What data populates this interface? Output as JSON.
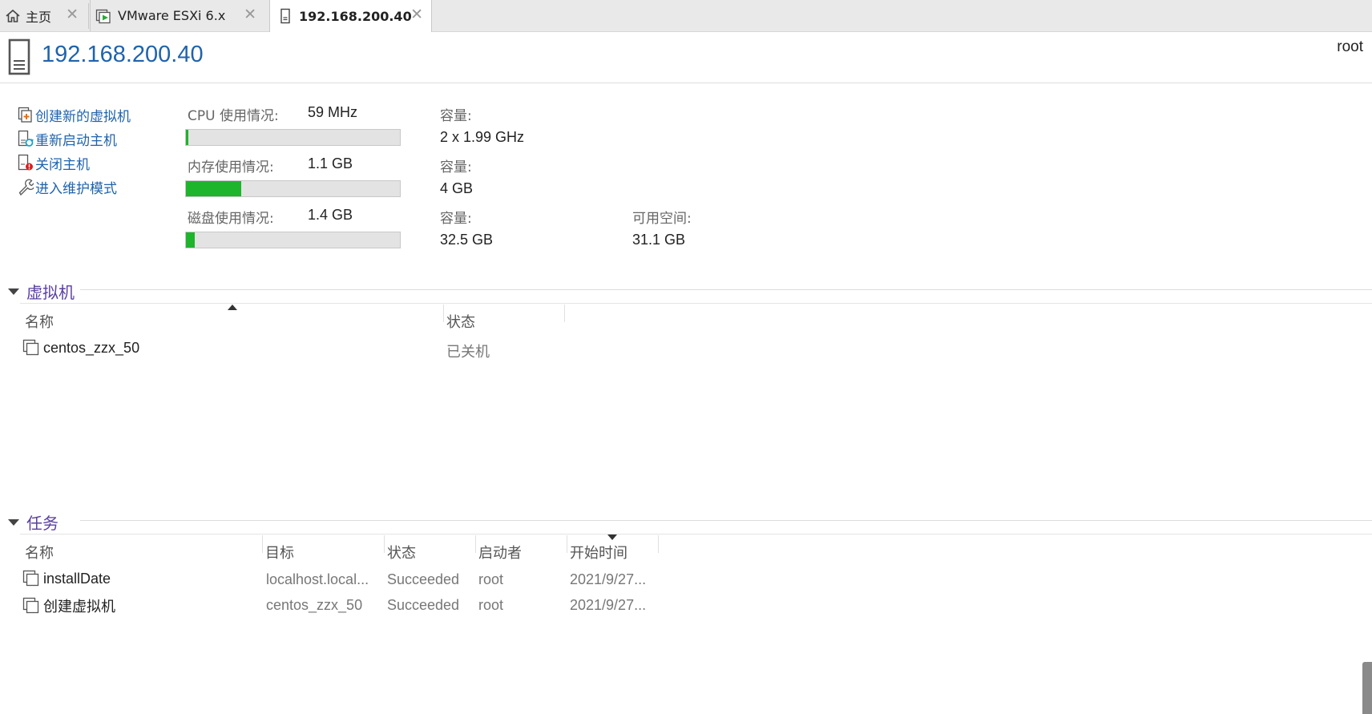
{
  "tabs": [
    {
      "label": "主页",
      "icon": "home-icon"
    },
    {
      "label": "VMware ESXi 6.x",
      "icon": "vm-play-icon"
    },
    {
      "label": "192.168.200.40",
      "icon": "server-icon",
      "active": true
    }
  ],
  "header": {
    "title": "192.168.200.40",
    "user": "root",
    "icon": "server-icon"
  },
  "actions": [
    {
      "label": "创建新的虚拟机",
      "icon": "create-vm-icon"
    },
    {
      "label": "重新启动主机",
      "icon": "restart-host-icon"
    },
    {
      "label": "关闭主机",
      "icon": "shutdown-host-icon"
    },
    {
      "label": "进入维护模式",
      "icon": "wrench-icon"
    }
  ],
  "stats": {
    "cpu": {
      "label": "CPU 使用情况:",
      "value": "59 MHz",
      "capacity_label": "容量:",
      "capacity": "2 x 1.99 GHz",
      "usage_fraction": 0.01
    },
    "memory": {
      "label": "内存使用情况:",
      "value": "1.1 GB",
      "capacity_label": "容量:",
      "capacity": "4 GB",
      "usage_fraction": 0.26
    },
    "disk": {
      "label": "磁盘使用情况:",
      "value": "1.4 GB",
      "capacity_label": "容量:",
      "capacity": "32.5 GB",
      "free_label": "可用空间:",
      "free": "31.1 GB",
      "usage_fraction": 0.04
    }
  },
  "vm_section": {
    "title": "虚拟机",
    "columns": [
      "名称",
      "状态"
    ],
    "rows": [
      {
        "name": "centos_zzx_50",
        "status": "已关机"
      }
    ]
  },
  "task_section": {
    "title": "任务",
    "columns": [
      "名称",
      "目标",
      "状态",
      "启动者",
      "开始时间"
    ],
    "rows": [
      {
        "name": "installDate",
        "target": "localhost.local...",
        "status": "Succeeded",
        "initiator": "root",
        "start": "2021/9/27..."
      },
      {
        "name": "创建虚拟机",
        "target": "centos_zzx_50",
        "status": "Succeeded",
        "initiator": "root",
        "start": "2021/9/27..."
      }
    ]
  },
  "colors": {
    "accent": "#1f63ad",
    "section": "#5a3fa0",
    "bar_fill": "#1eb42c"
  }
}
